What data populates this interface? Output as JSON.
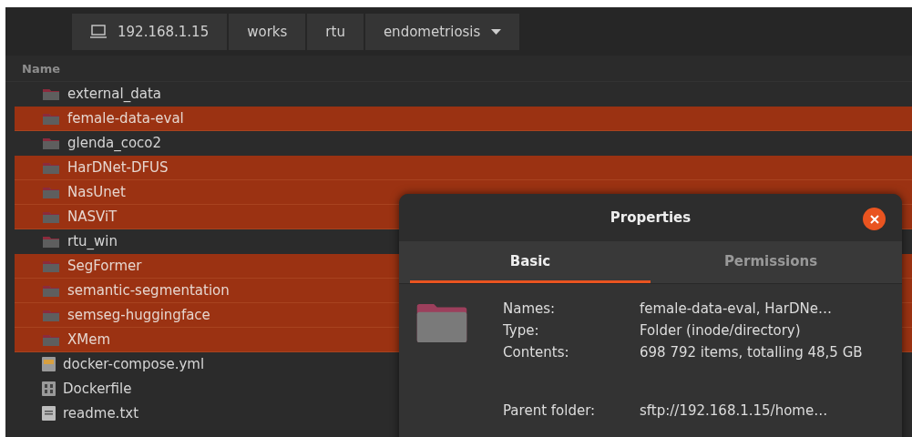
{
  "path_bar": [
    {
      "label": "192.168.1.15",
      "kind": "host"
    },
    {
      "label": "works",
      "kind": "folder"
    },
    {
      "label": "rtu",
      "kind": "folder"
    },
    {
      "label": "endometriosis",
      "kind": "current"
    }
  ],
  "file_list": {
    "columns": [
      "Name"
    ],
    "rows": [
      {
        "name": "external_data",
        "kind": "folder",
        "selected": false
      },
      {
        "name": "female-data-eval",
        "kind": "folder",
        "selected": true
      },
      {
        "name": "glenda_coco2",
        "kind": "folder",
        "selected": false
      },
      {
        "name": "HarDNet-DFUS",
        "kind": "folder",
        "selected": true
      },
      {
        "name": "NasUnet",
        "kind": "folder",
        "selected": true
      },
      {
        "name": "NASViT",
        "kind": "folder",
        "selected": true
      },
      {
        "name": "rtu_win",
        "kind": "folder",
        "selected": false
      },
      {
        "name": "SegFormer",
        "kind": "folder",
        "selected": true
      },
      {
        "name": "semantic-segmentation",
        "kind": "folder",
        "selected": true
      },
      {
        "name": "semseg-huggingface",
        "kind": "folder",
        "selected": true
      },
      {
        "name": "XMem",
        "kind": "folder",
        "selected": true
      },
      {
        "name": "docker-compose.yml",
        "kind": "yaml",
        "selected": false
      },
      {
        "name": "Dockerfile",
        "kind": "binary",
        "selected": false
      },
      {
        "name": "readme.txt",
        "kind": "text",
        "selected": false
      }
    ]
  },
  "dialog": {
    "title": "Properties",
    "tabs": [
      {
        "label": "Basic",
        "selected": true
      },
      {
        "label": "Permissions",
        "selected": false
      }
    ],
    "fields": [
      {
        "label": "Names:",
        "value": "female-data-eval, HarDNe…"
      },
      {
        "label": "Type:",
        "value": "Folder (inode/directory)"
      },
      {
        "label": "Contents:",
        "value": "698 792 items, totalling 48,5 GB"
      },
      {
        "label": "Parent folder:",
        "value": "sftp://192.168.1.15/home…"
      }
    ]
  }
}
